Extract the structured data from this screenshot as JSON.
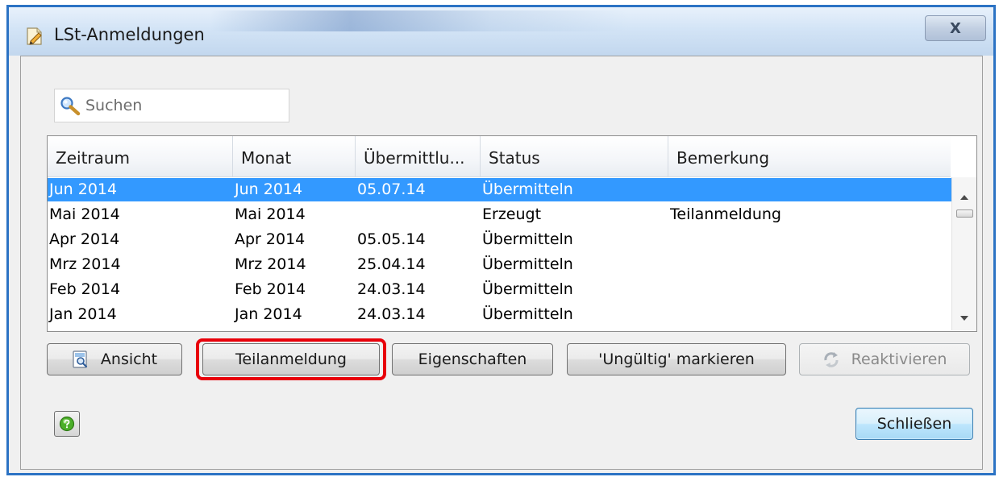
{
  "window": {
    "title": "LSt-Anmeldungen",
    "close_glyph": "X"
  },
  "search": {
    "placeholder": "Suchen",
    "value": ""
  },
  "table": {
    "columns": [
      "Zeitraum",
      "Monat",
      "Übermittlu...",
      "Status",
      "Bemerkung"
    ],
    "rows": [
      {
        "zeitraum": "Jun 2014",
        "monat": "Jun 2014",
        "uebermittlung": "05.07.14",
        "status": "Übermitteln",
        "bemerkung": "",
        "selected": true
      },
      {
        "zeitraum": "Mai 2014",
        "monat": "Mai 2014",
        "uebermittlung": "",
        "status": "Erzeugt",
        "bemerkung": "Teilanmeldung",
        "selected": false
      },
      {
        "zeitraum": "Apr 2014",
        "monat": "Apr 2014",
        "uebermittlung": "05.05.14",
        "status": "Übermitteln",
        "bemerkung": "",
        "selected": false
      },
      {
        "zeitraum": "Mrz 2014",
        "monat": "Mrz 2014",
        "uebermittlung": "25.04.14",
        "status": "Übermitteln",
        "bemerkung": "",
        "selected": false
      },
      {
        "zeitraum": "Feb 2014",
        "monat": "Feb 2014",
        "uebermittlung": "24.03.14",
        "status": "Übermitteln",
        "bemerkung": "",
        "selected": false
      },
      {
        "zeitraum": "Jan 2014",
        "monat": "Jan 2014",
        "uebermittlung": "24.03.14",
        "status": "Übermitteln",
        "bemerkung": "",
        "selected": false
      }
    ]
  },
  "buttons": {
    "ansicht": "Ansicht",
    "teilanmeldung": "Teilanmeldung",
    "eigenschaften": "Eigenschaften",
    "ungueltig": "'Ungültig' markieren",
    "reaktivieren": "Reaktivieren",
    "schliessen": "Schließen"
  },
  "icons": {
    "title": "document-pencil-icon",
    "search": "magnifier-icon",
    "ansicht": "preview-document-icon",
    "reaktivieren": "reactivate-arrows-icon",
    "help": "help-green-circle-icon"
  },
  "colors": {
    "selection": "#3399ff",
    "highlight_annotation": "#e8000a",
    "window_border": "#2c73c4"
  }
}
